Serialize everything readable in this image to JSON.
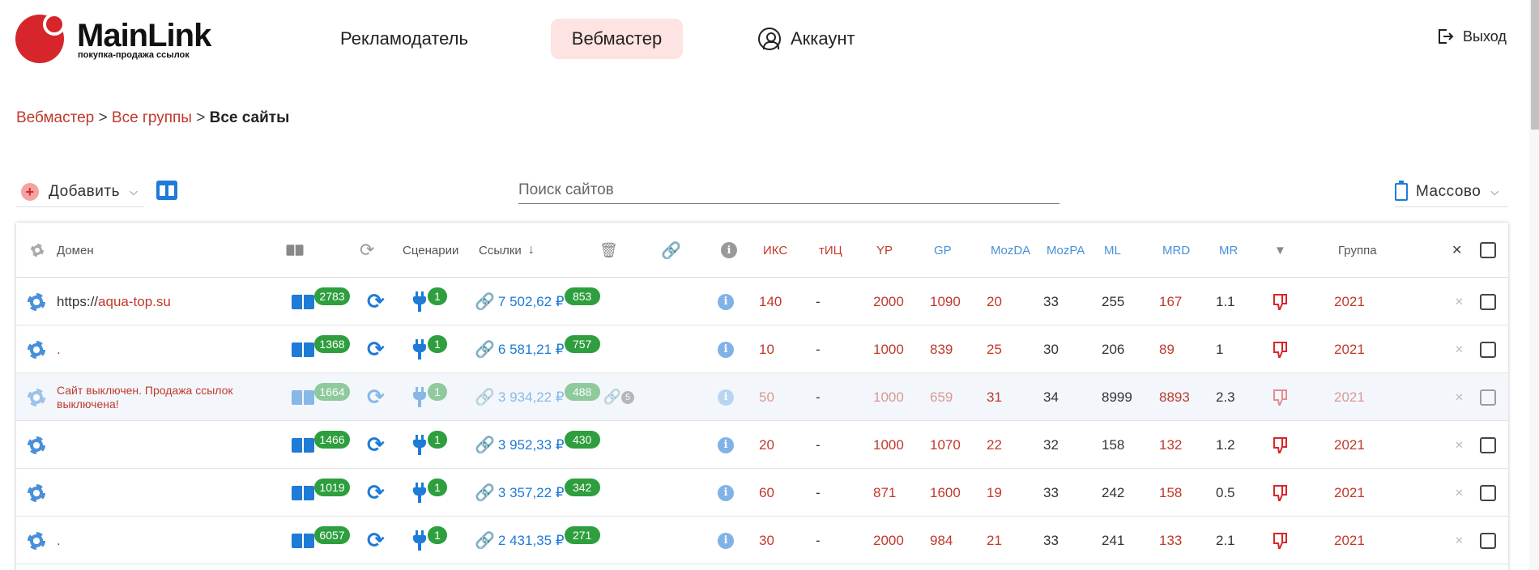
{
  "brand": {
    "name": "MainLink",
    "tagline": "покупка-продажа ссылок",
    "color": "#d6262b"
  },
  "nav": {
    "advertiser": "Рекламодатель",
    "webmaster": "Вебмастер",
    "account": "Аккаунт",
    "logout": "Выход",
    "active": "webmaster"
  },
  "breadcrumb": {
    "item1": "Вебмастер",
    "sep1": " > ",
    "item2": "Все группы",
    "sep2": " > ",
    "current": "Все сайты"
  },
  "toolbar": {
    "add_label": "Добавить",
    "search_placeholder": "Поиск сайтов",
    "mass_label": "Массово"
  },
  "columns": {
    "domain": "Домен",
    "scenarios": "Сценарии",
    "links": "Ссылки",
    "iks": "ИКС",
    "tic": "тИЦ",
    "yp": "YP",
    "gp": "GP",
    "mozda": "MozDA",
    "mozpa": "MozPA",
    "ml": "ML",
    "mrd": "MRD",
    "mr": "MR",
    "group": "Группа"
  },
  "rows": [
    {
      "domain_prefix": "https://",
      "domain_name": "aqua-top.su",
      "notice": "",
      "pages": "2783",
      "scenarios": "1",
      "price": "7 502,62 ₽",
      "links": "853",
      "extra": "",
      "iks": "140",
      "tic": "-",
      "yp": "2000",
      "gp": "1090",
      "mozda": "20",
      "mozpa": "33",
      "ml": "255",
      "mrd": "167",
      "mr": "1.1",
      "group": "2021",
      "disabled": false
    },
    {
      "domain_prefix": "",
      "domain_name": ".",
      "notice": "",
      "pages": "1368",
      "scenarios": "1",
      "price": "6 581,21 ₽",
      "links": "757",
      "extra": "",
      "iks": "10",
      "tic": "-",
      "yp": "1000",
      "gp": "839",
      "mozda": "25",
      "mozpa": "30",
      "ml": "206",
      "mrd": "89",
      "mr": "1",
      "group": "2021",
      "disabled": false
    },
    {
      "domain_prefix": "",
      "domain_name": "",
      "notice": "Сайт выключен. Продажа ссылок выключена!",
      "pages": "1664",
      "scenarios": "1",
      "price": "3 934,22 ₽",
      "links": "488",
      "extra": "5",
      "iks": "50",
      "tic": "-",
      "yp": "1000",
      "gp": "659",
      "mozda": "31",
      "mozpa": "34",
      "ml": "8999",
      "mrd": "8893",
      "mr": "2.3",
      "group": "2021",
      "disabled": true
    },
    {
      "domain_prefix": "",
      "domain_name": "",
      "notice": "",
      "pages": "1466",
      "scenarios": "1",
      "price": "3 952,33 ₽",
      "links": "430",
      "extra": "",
      "iks": "20",
      "tic": "-",
      "yp": "1000",
      "gp": "1070",
      "mozda": "22",
      "mozpa": "32",
      "ml": "158",
      "mrd": "132",
      "mr": "1.2",
      "group": "2021",
      "disabled": false
    },
    {
      "domain_prefix": "",
      "domain_name": "",
      "notice": "",
      "pages": "1019",
      "scenarios": "1",
      "price": "3 357,22 ₽",
      "links": "342",
      "extra": "",
      "iks": "60",
      "tic": "-",
      "yp": "871",
      "gp": "1600",
      "mozda": "19",
      "mozpa": "33",
      "ml": "242",
      "mrd": "158",
      "mr": "0.5",
      "group": "2021",
      "disabled": false
    },
    {
      "domain_prefix": "",
      "domain_name": ".",
      "notice": "",
      "pages": "6057",
      "scenarios": "1",
      "price": "2 431,35 ₽",
      "links": "271",
      "extra": "",
      "iks": "30",
      "tic": "-",
      "yp": "2000",
      "gp": "984",
      "mozda": "21",
      "mozpa": "33",
      "ml": "241",
      "mrd": "133",
      "mr": "2.1",
      "group": "2021",
      "disabled": false
    }
  ]
}
